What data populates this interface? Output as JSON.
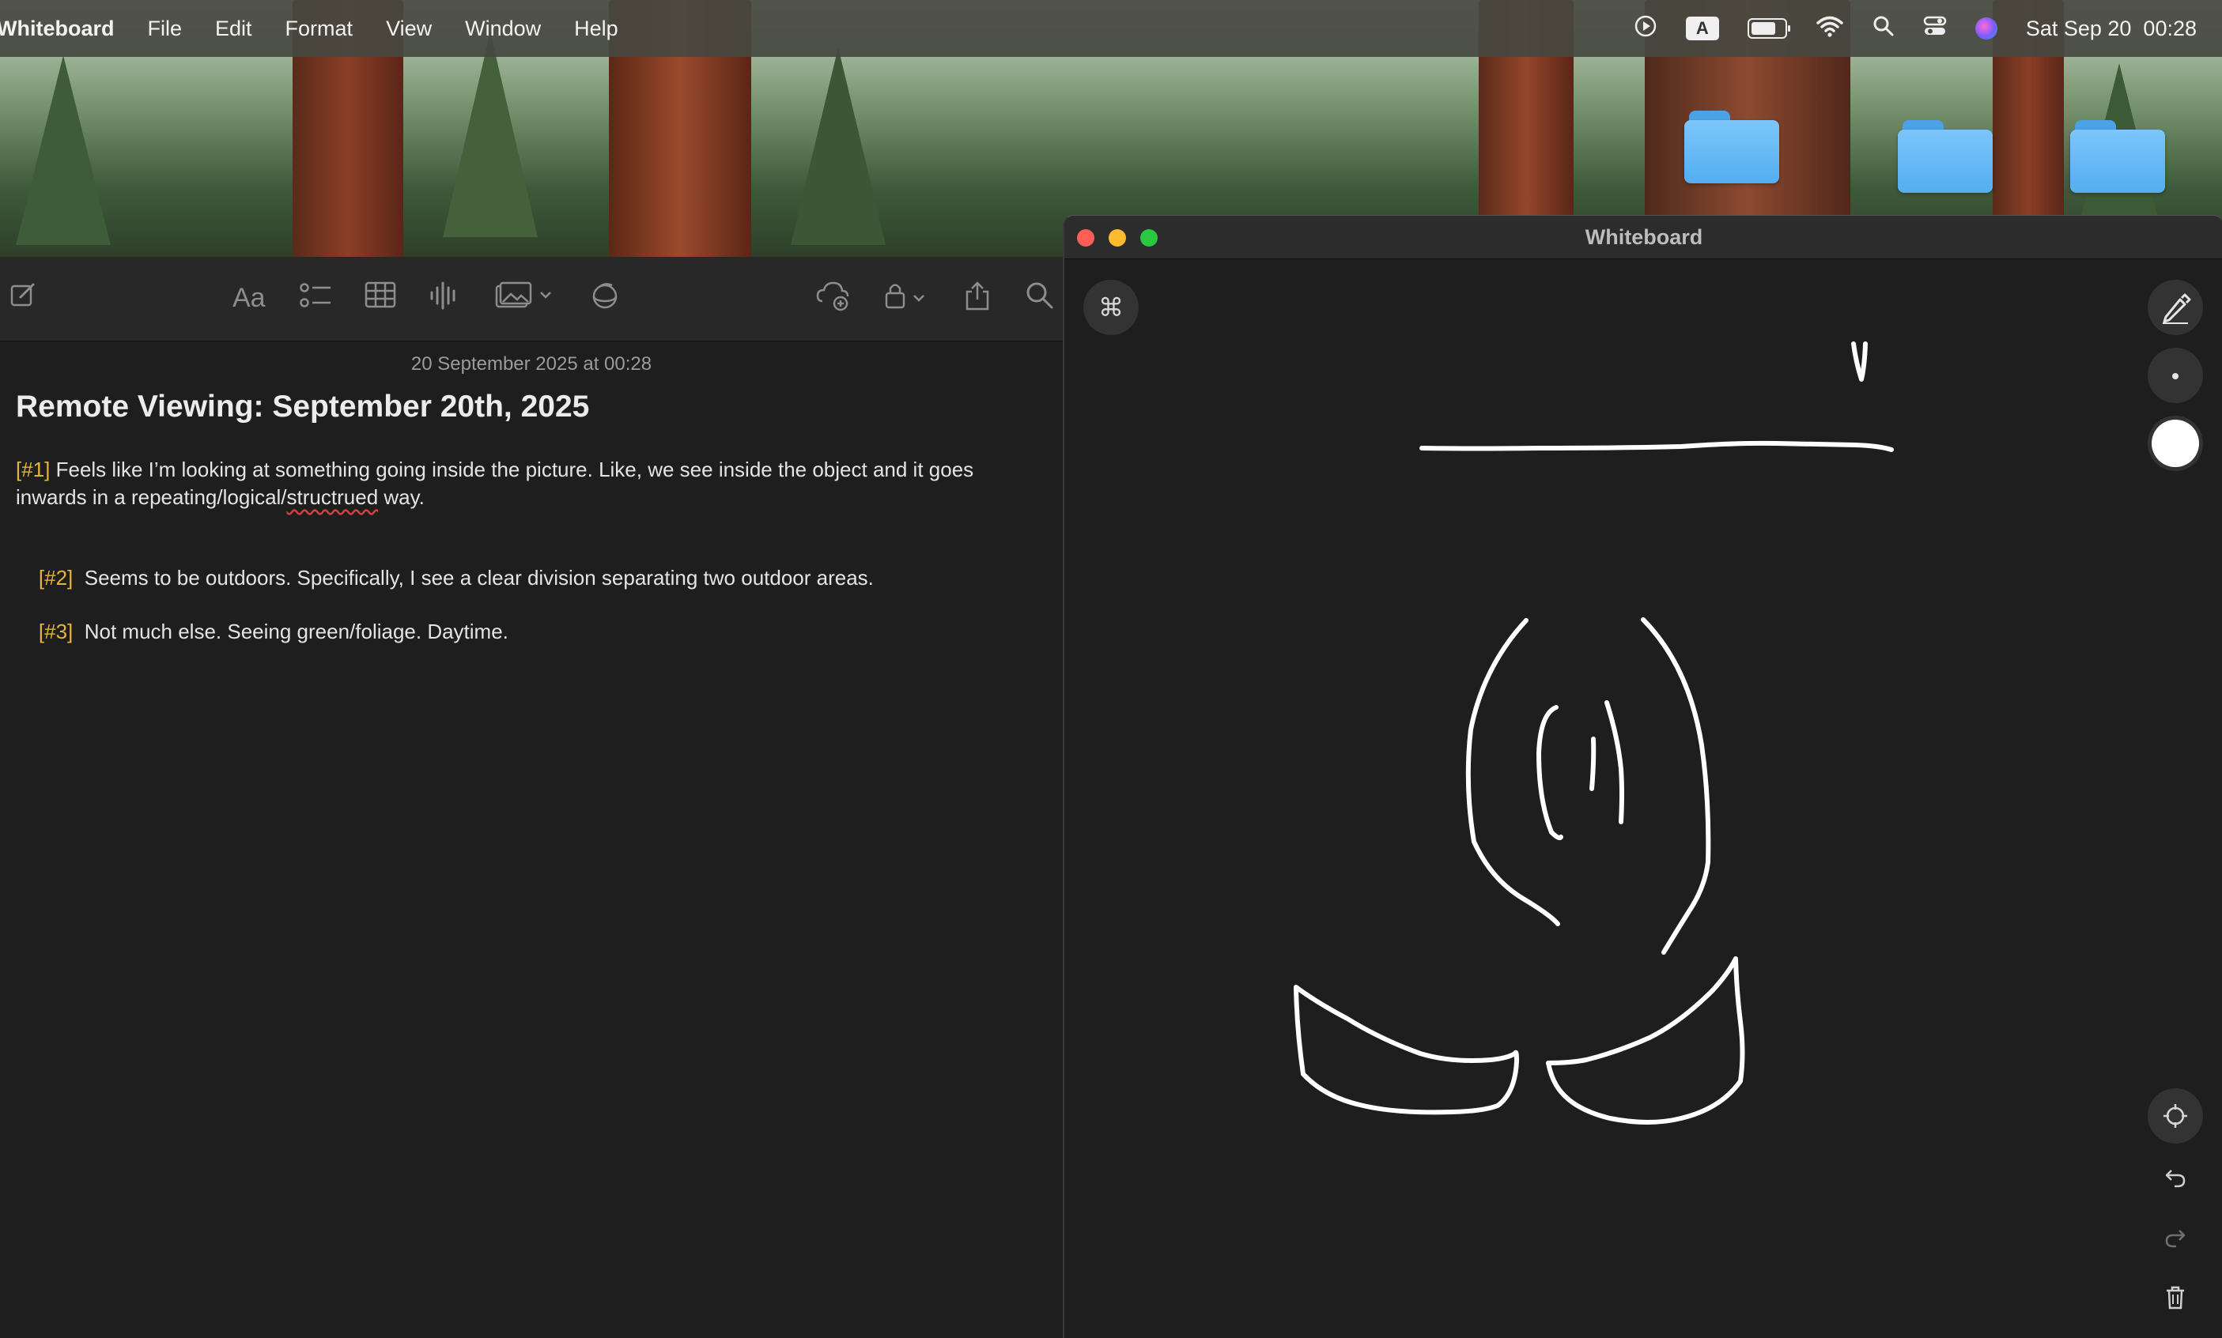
{
  "menubar": {
    "app_name": "Whiteboard",
    "menus": [
      "File",
      "Edit",
      "Format",
      "View",
      "Window",
      "Help"
    ],
    "input_source": "A",
    "datetime": "Sat Sep 20  00:28",
    "battery_level_fraction": 0.75
  },
  "notes": {
    "date": "20 September 2025 at 00:28",
    "title": "Remote Viewing: September 20th, 2025",
    "entries": [
      {
        "tag": "[#1]",
        "text_before": " Feels like I’m looking at something going inside the picture. Like, we see inside the object and it goes inwards in a repeating/logical/",
        "misspelled": "structrued",
        "text_after": " way."
      },
      {
        "tag": "[#2]",
        "text": "  Seems to be outdoors. Specifically, I see a clear division separating two outdoor areas."
      },
      {
        "tag": "[#3]",
        "text": "  Not much else. Seeing green/foliage. Daytime."
      }
    ]
  },
  "whiteboard": {
    "title": "Whiteboard",
    "command_glyph": "⌘",
    "stroke_color": "#ffffff",
    "canvas_color": "#1e1e1e"
  },
  "colors": {
    "tag": "#e6b43c",
    "close": "#ff5f57",
    "minimize": "#febc2e",
    "zoom": "#28c840"
  }
}
